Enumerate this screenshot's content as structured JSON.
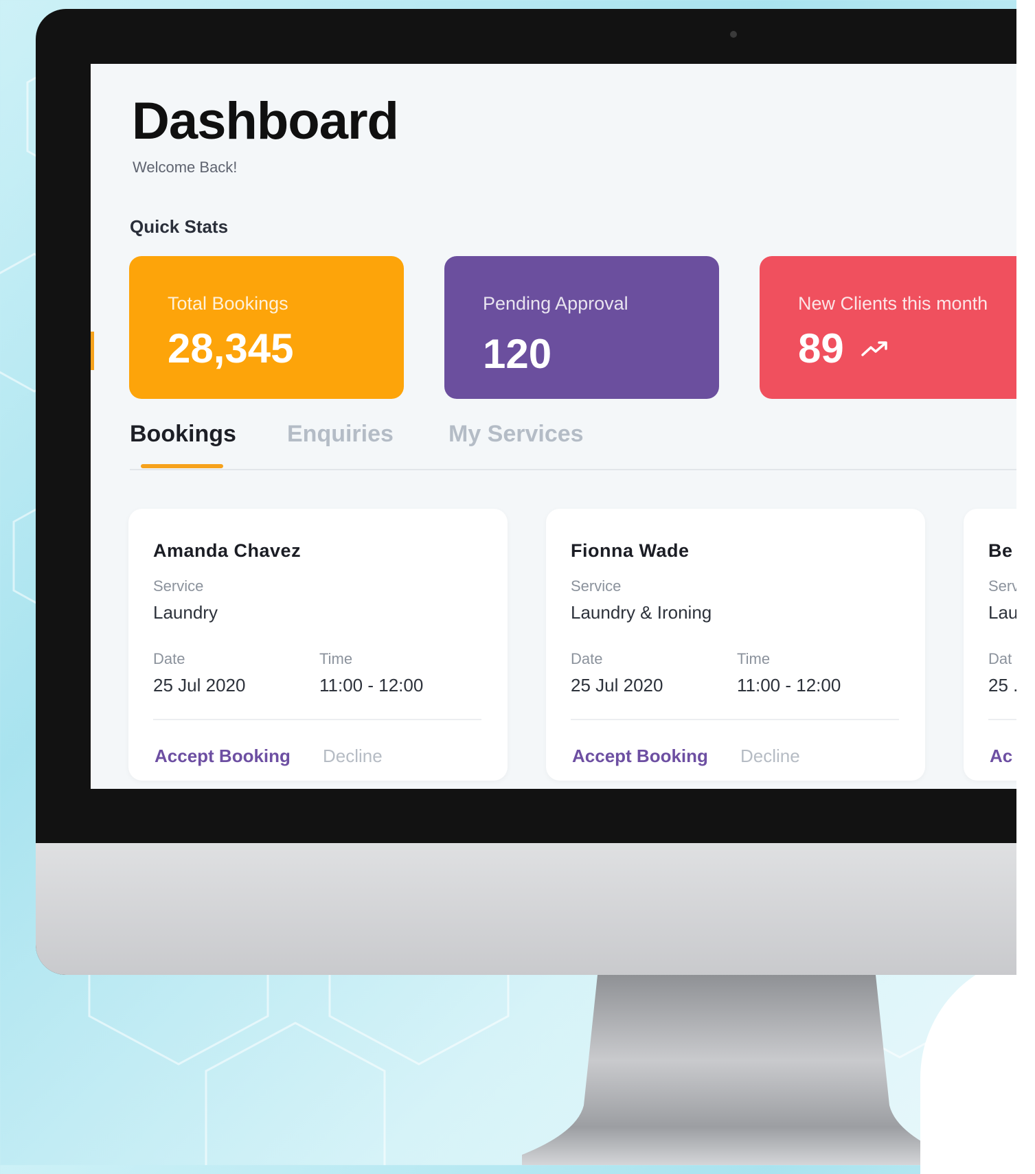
{
  "page": {
    "title": "Dashboard",
    "subtitle": "Welcome Back!"
  },
  "quick_stats": {
    "heading": "Quick Stats",
    "cards": [
      {
        "label": "Total Bookings",
        "value": "28,345",
        "color": "#fda40a"
      },
      {
        "label": "Pending Approval",
        "value": "120",
        "color": "#6b4f9e"
      },
      {
        "label": "New Clients this month",
        "value": "89",
        "color": "#f0505e",
        "icon": "trending-up-icon"
      }
    ]
  },
  "tabs": [
    {
      "label": "Bookings",
      "active": true
    },
    {
      "label": "Enquiries",
      "active": false
    },
    {
      "label": "My Services",
      "active": false
    }
  ],
  "bookings": [
    {
      "name": "Amanda Chavez",
      "service_label": "Service",
      "service": "Laundry",
      "date_label": "Date",
      "date": "25 Jul 2020",
      "time_label": "Time",
      "time": "11:00 - 12:00",
      "accept": "Accept Booking",
      "decline": "Decline"
    },
    {
      "name": "Fionna Wade",
      "service_label": "Service",
      "service": "Laundry & Ironing",
      "date_label": "Date",
      "date": "25 Jul 2020",
      "time_label": "Time",
      "time": "11:00 - 12:00",
      "accept": "Accept Booking",
      "decline": "Decline"
    },
    {
      "name": "Be",
      "service_label": "Serv",
      "service": "Lau",
      "date_label": "Dat",
      "date": "25 .",
      "accept": "Ac"
    }
  ],
  "colors": {
    "accent_orange": "#f6a21c",
    "accent_purple": "#6d4fa2"
  }
}
